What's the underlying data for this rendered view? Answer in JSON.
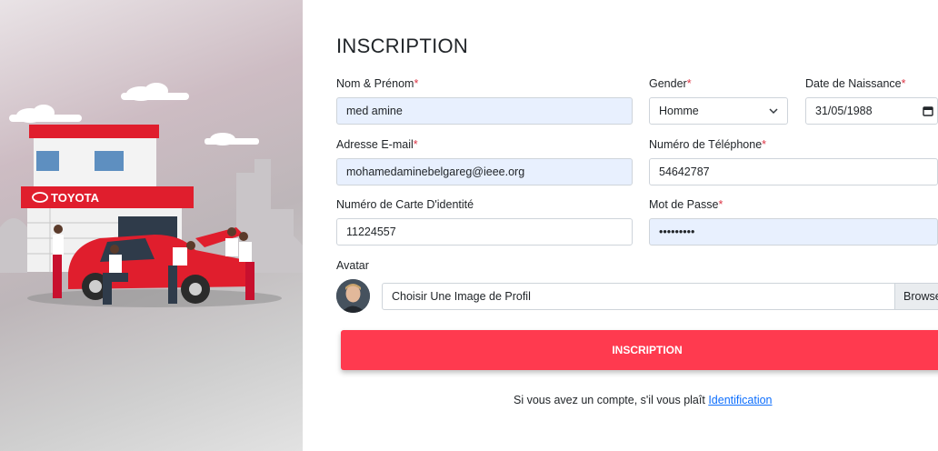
{
  "brand": {
    "name": "TOYOTA"
  },
  "form": {
    "title": "INSCRIPTION",
    "fields": {
      "name": {
        "label": "Nom & Prénom",
        "required": "*",
        "value": "med amine"
      },
      "gender": {
        "label": "Gender",
        "required": "*",
        "value": "Homme"
      },
      "birthdate": {
        "label": "Date de Naissance",
        "required": "*",
        "value": "31/05/1988"
      },
      "email": {
        "label": "Adresse E-mail",
        "required": "*",
        "value": "mohamedaminebelgareg@ieee.org"
      },
      "phone": {
        "label": "Numéro de Téléphone",
        "required": "*",
        "value": "54642787"
      },
      "id_card": {
        "label": "Numéro de Carte D'identité",
        "required": "",
        "value": "11224557"
      },
      "password": {
        "label": "Mot de Passe",
        "required": "*",
        "value": "•••••••••"
      },
      "avatar": {
        "label": "Avatar",
        "placeholder": "Choisir Une Image de Profil",
        "browse_label": "Browse"
      }
    },
    "submit_label": "INSCRIPTION",
    "footer": {
      "text": "Si vous avez un compte, s'il vous plaît",
      "link_label": "Identification"
    }
  },
  "colors": {
    "accent": "#ff3a4f",
    "link": "#0d6efd",
    "required": "#dc3545",
    "autofill": "#e8f0fe"
  },
  "icons": {
    "select": "chevron-down-icon",
    "date": "calendar-icon"
  }
}
